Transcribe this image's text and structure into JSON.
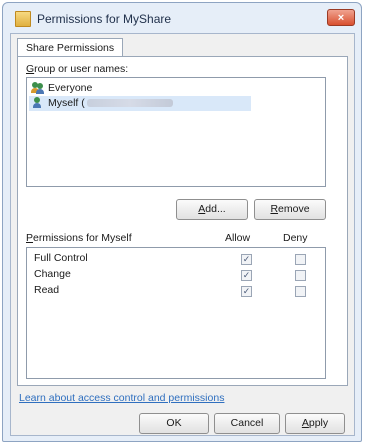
{
  "window": {
    "title": "Permissions for MyShare",
    "close_glyph": "×"
  },
  "tab": {
    "label": "Share Permissions"
  },
  "group_section": {
    "label_prefix": "",
    "label_accel": "G",
    "label_rest": "roup or user names:",
    "users": [
      {
        "name": "Everyone",
        "icon": "users-group-icon",
        "selected": false
      },
      {
        "name": "Myself (",
        "suffix_obscured": true,
        "icon": "user-icon",
        "selected": true
      }
    ]
  },
  "buttons": {
    "add_accel": "A",
    "add_rest": "dd...",
    "remove_accel": "R",
    "remove_rest": "emove",
    "ok": "OK",
    "cancel": "Cancel",
    "apply_accel": "A",
    "apply_rest": "pply"
  },
  "permissions": {
    "label_accel": "P",
    "label_rest": "ermissions for Myself",
    "allow_header": "Allow",
    "deny_header": "Deny",
    "rows": [
      {
        "name": "Full Control",
        "allow": true,
        "deny": false
      },
      {
        "name": "Change",
        "allow": true,
        "deny": false
      },
      {
        "name": "Read",
        "allow": true,
        "deny": false
      }
    ]
  },
  "help_link": "Learn about access control and permissions",
  "check_glyph": "✓"
}
